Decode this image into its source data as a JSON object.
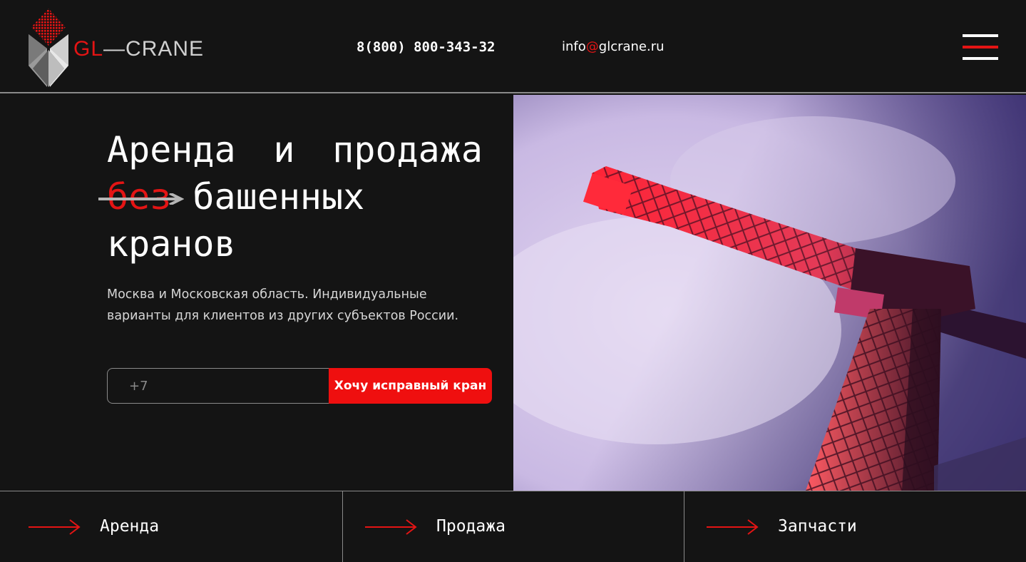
{
  "header": {
    "logo": {
      "gl": "GL",
      "dash": "—",
      "crane": "CRANE"
    },
    "phone": "8(800) 800-343-32",
    "email": {
      "user": "info",
      "at": "@",
      "domain": "glcrane.ru"
    }
  },
  "hero": {
    "title_line1_a": "Аренда",
    "title_line1_b": "и",
    "title_line1_c": "продажа",
    "title_strike": "без",
    "title_line2": "башенных",
    "title_line3": "кранов",
    "subtitle": "Москва и Московская область. Индивидуальные варианты для клиентов из других субъектов России.",
    "phone_placeholder": "+7",
    "cta_label": "Хочу исправный кран"
  },
  "nav": {
    "items": [
      {
        "label": "Аренда"
      },
      {
        "label": "Продажа"
      },
      {
        "label": "Запчасти"
      }
    ]
  },
  "colors": {
    "accent": "#ef0f0f",
    "background": "#141414",
    "border": "#8a8a8a",
    "menu_bars": [
      "#ffffff",
      "#e41414",
      "#ffffff"
    ]
  },
  "icons": [
    "logo-icon",
    "menu-icon",
    "arrow-right-icon",
    "crane-photo"
  ]
}
